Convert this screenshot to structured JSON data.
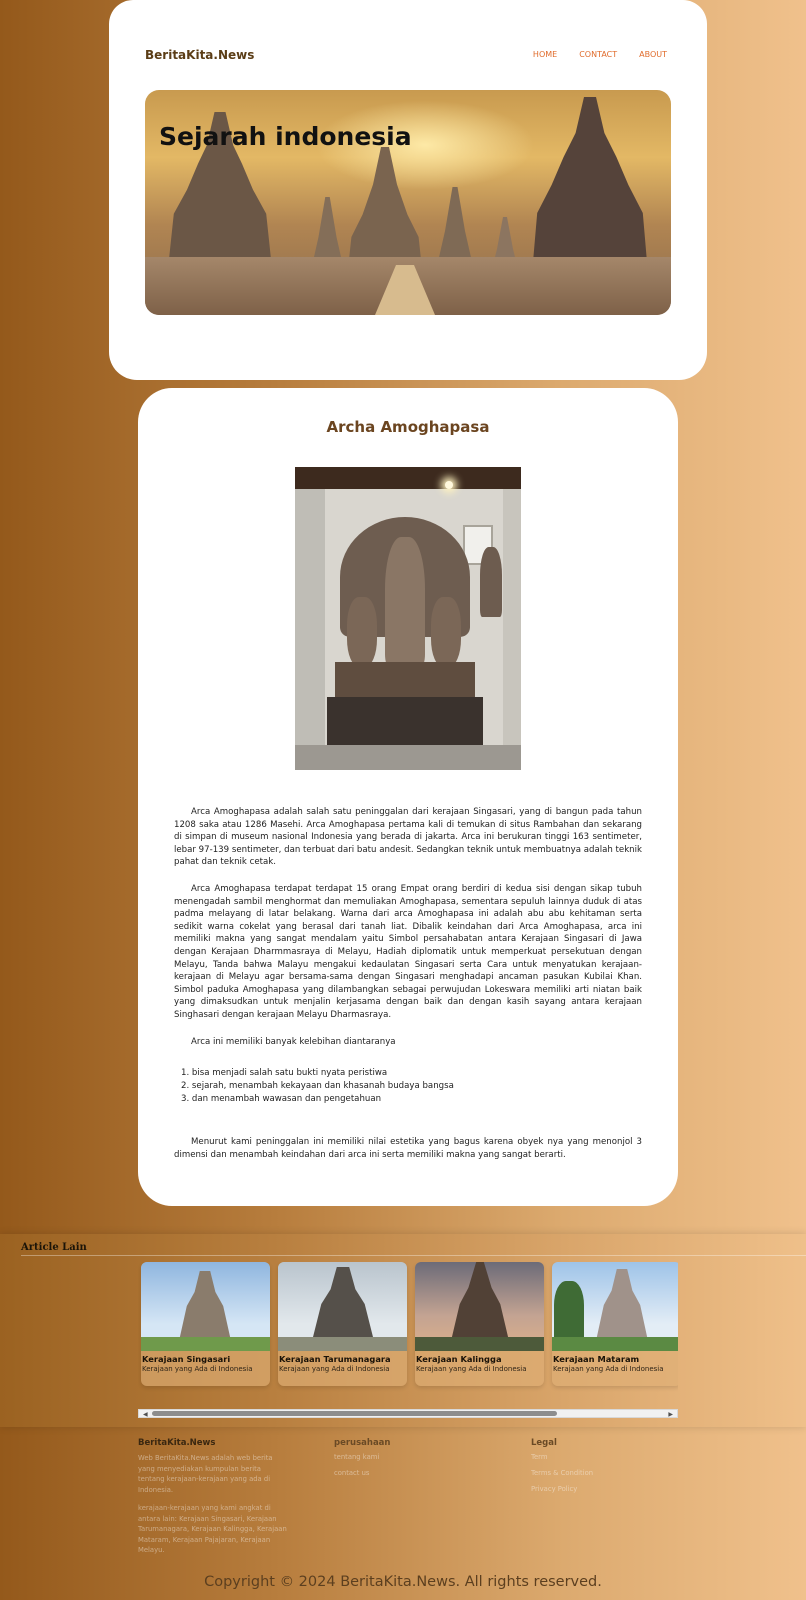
{
  "header": {
    "brand": "BeritaKita.News",
    "nav": [
      "HOME",
      "CONTACT",
      "ABOUT"
    ],
    "hero_title": "Sejarah indonesia"
  },
  "article": {
    "title": "Archa Amoghapasa",
    "paragraphs": [
      "Arca Amoghapasa adalah salah satu peninggalan dari kerajaan Singasari, yang di bangun pada tahun 1208 saka atau 1286 Masehi. Arca Amoghapasa pertama kali di temukan di situs Rambahan dan sekarang di simpan di museum nasional Indonesia yang berada di jakarta. Arca ini berukuran tinggi 163 sentimeter, lebar 97-139 sentimeter, dan terbuat dari batu andesit. Sedangkan teknik untuk membuatnya adalah teknik pahat dan teknik cetak.",
      "Arca Amoghapasa terdapat terdapat 15 orang Empat orang berdiri di kedua sisi dengan sikap tubuh menengadah sambil menghormat dan memuliakan Amoghapasa, sementara sepuluh lainnya duduk di atas padma melayang di latar belakang. Warna dari arca Amoghapasa ini adalah abu abu kehitaman serta sedikit warna cokelat yang berasal dari tanah liat. Dibalik keindahan dari Arca Amoghapasa, arca ini memiliki makna yang sangat mendalam yaitu Simbol persahabatan antara Kerajaan Singasari di Jawa dengan Kerajaan Dharmmasraya di Melayu, Hadiah diplomatik untuk memperkuat persekutuan dengan Melayu, Tanda bahwa Malayu mengakui kedaulatan Singasari serta Cara untuk menyatukan kerajaan-kerajaan di Melayu agar bersama-sama dengan Singasari menghadapi ancaman pasukan Kubilai Khan. Simbol paduka Amoghapasa yang dilambangkan sebagai perwujudan Lokeswara memiliki arti niatan baik yang dimaksudkan untuk menjalin kerjasama dengan baik dan dengan kasih sayang antara kerajaan Singhasari dengan kerajaan Melayu Dharmasraya.",
      "Arca ini memiliki banyak kelebihan diantaranya"
    ],
    "list": [
      "1. bisa menjadi salah satu bukti nyata peristiwa",
      "2. sejarah, menambah kekayaan dan khasanah budaya bangsa",
      "3. dan menambah wawasan dan pengetahuan"
    ],
    "closing": "Menurut kami peninggalan ini memiliki nilai estetika yang bagus karena obyek nya yang menonjol 3 dimensi dan menambah keindahan dari arca ini serta memiliki makna yang sangat berarti."
  },
  "article_lain": {
    "title": "Article Lain",
    "cards": [
      {
        "title": "Kerajaan Singasari",
        "subtitle": "Kerajaan yang Ada di Indonesia"
      },
      {
        "title": "Kerajaan Tarumanagara",
        "subtitle": "Kerajaan yang Ada di Indonesia"
      },
      {
        "title": "Kerajaan Kalingga",
        "subtitle": "Kerajaan yang Ada di Indonesia"
      },
      {
        "title": "Kerajaan Mataram",
        "subtitle": "Kerajaan yang Ada di Indonesia"
      }
    ]
  },
  "footer": {
    "col1": {
      "title": "BeritaKita.News",
      "text1": "Web BeritaKita.News adalah web berita yang menyediakan kumpulan berita tentang kerajaan-kerajaan yang ada di Indonesia.",
      "text2": "kerajaan-kerajaan yang kami angkat di antara lain: Kerajaan Singasari, Kerajaan Tarumanagara, Kerajaan Kalingga, Kerajaan Mataram, Kerajaan Pajajaran, Kerajaan Melayu."
    },
    "col2": {
      "title": "perusahaan",
      "links": [
        "tentang kami",
        "contact us"
      ]
    },
    "col3": {
      "title": "Legal",
      "links": [
        "Term",
        "Terms & Condition",
        "Privacy Policy"
      ]
    },
    "copyright": "Copyright © 2024 BeritaKita.News. All rights reserved."
  },
  "colors": {
    "brand_text": "#5b3d16",
    "nav_accent": "#e06c2c",
    "article_title": "#6b4520",
    "background_left": "#94591b",
    "background_right": "#f0c18c"
  },
  "icons": [
    "scroll-left-arrow-icon",
    "scroll-right-arrow-icon"
  ]
}
